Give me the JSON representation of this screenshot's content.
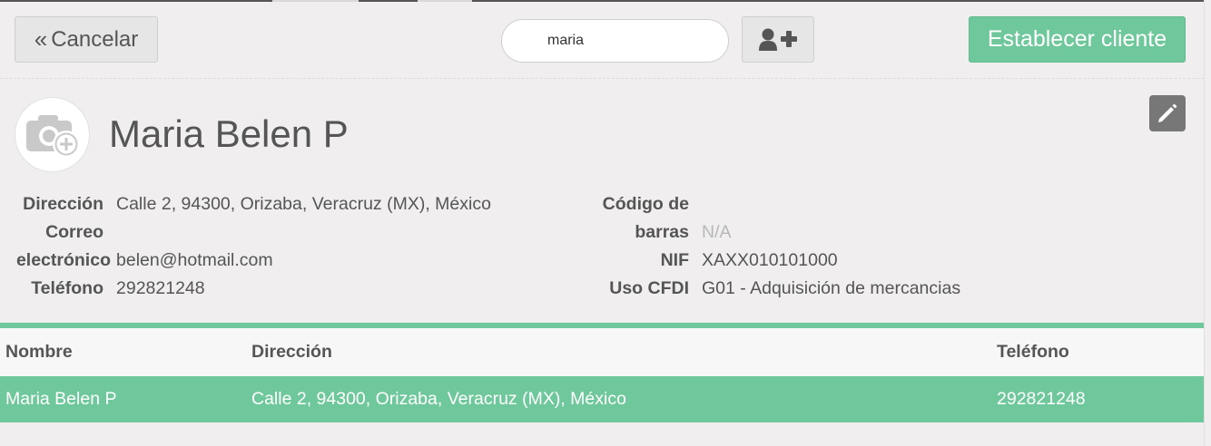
{
  "header": {
    "cancel_label": "Cancelar",
    "search": {
      "value": "maria",
      "placeholder": ""
    },
    "set_customer_label": "Establecer cliente"
  },
  "customer": {
    "name": "Maria Belen P",
    "fields_left": [
      {
        "label": "Dirección",
        "value": "Calle 2, 94300, Orizaba, Veracruz (MX), México"
      },
      {
        "label_line1": "Correo",
        "label_line2": "electrónico",
        "value": "belen@hotmail.com"
      },
      {
        "label": "Teléfono",
        "value": "292821248"
      }
    ],
    "fields_right": [
      {
        "label_line1": "Código de",
        "label_line2": "barras",
        "value": "N/A"
      },
      {
        "label": "NIF",
        "value": "XAXX010101000"
      },
      {
        "label": "Uso CFDI",
        "value": "G01 - Adquisición de mercancias"
      }
    ]
  },
  "table": {
    "columns": [
      "Nombre",
      "Dirección",
      "Teléfono"
    ],
    "rows": [
      {
        "name": "Maria Belen P",
        "address": "Calle 2, 94300, Orizaba, Veracruz (MX), México",
        "phone": "292821248",
        "selected": true
      }
    ]
  },
  "icons": {
    "cancel": "double-chevron-left-icon",
    "add_customer": "user-plus-icon",
    "avatar": "camera-plus-icon",
    "edit": "pencil-icon"
  },
  "colors": {
    "accent": "#6ec89b",
    "background": "#f0eeee",
    "text": "#555555"
  }
}
